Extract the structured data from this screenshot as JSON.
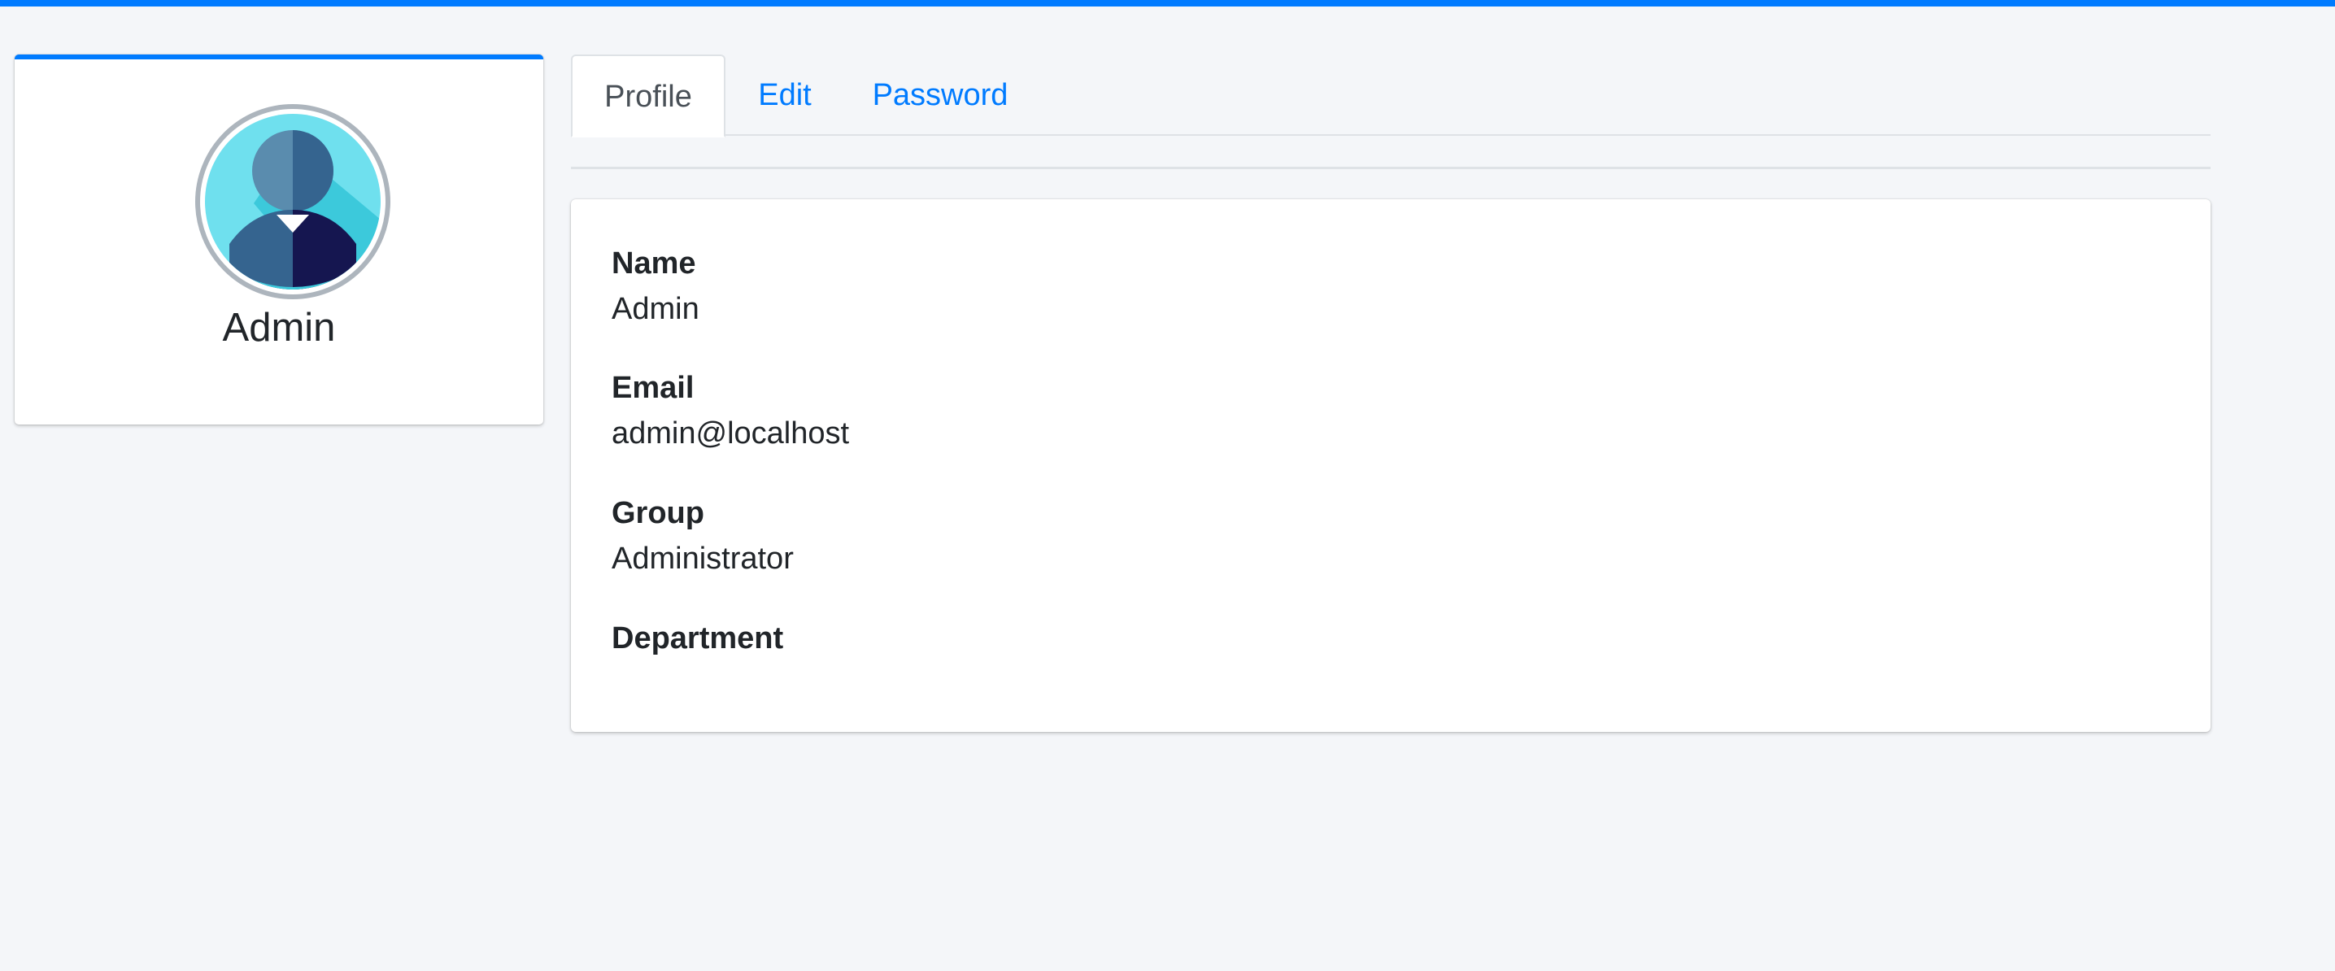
{
  "profile": {
    "name": "Admin",
    "avatar_icon": "user-avatar-icon"
  },
  "tabs": [
    {
      "label": "Profile",
      "active": true
    },
    {
      "label": "Edit",
      "active": false
    },
    {
      "label": "Password",
      "active": false
    }
  ],
  "details": {
    "name_label": "Name",
    "name_value": "Admin",
    "email_label": "Email",
    "email_value": "admin@localhost",
    "group_label": "Group",
    "group_value": "Administrator",
    "department_label": "Department",
    "department_value": ""
  },
  "colors": {
    "accent": "#007bff",
    "background": "#f4f6f9"
  }
}
